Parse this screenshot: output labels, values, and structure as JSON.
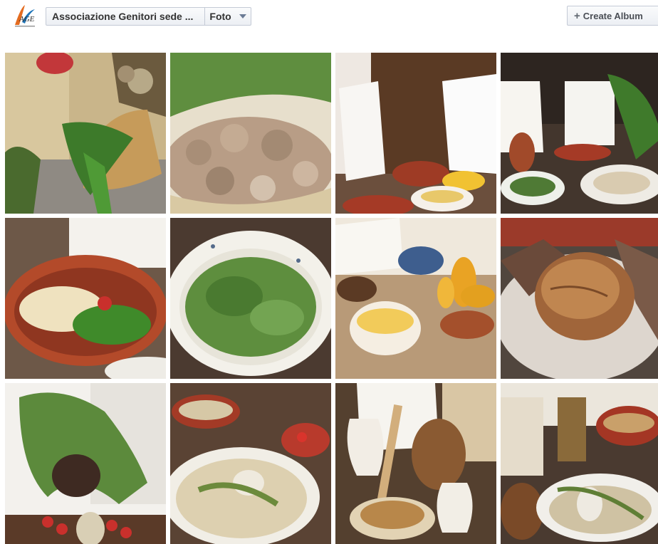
{
  "header": {
    "page_name": "Associazione Genitori sede ...",
    "section": "Foto",
    "create_album_label": "Create Album"
  },
  "photos": [
    {
      "subject": "herbs-basket"
    },
    {
      "subject": "dried-flowers"
    },
    {
      "subject": "menu-cards-corn"
    },
    {
      "subject": "menu-cards-bowls"
    },
    {
      "subject": "orecchiette-bowl"
    },
    {
      "subject": "greens-plate"
    },
    {
      "subject": "corn-polenta"
    },
    {
      "subject": "bread-basket"
    },
    {
      "subject": "olive-branches"
    },
    {
      "subject": "beans-plate"
    },
    {
      "subject": "chickpeas-jug"
    },
    {
      "subject": "jars-plate"
    }
  ]
}
